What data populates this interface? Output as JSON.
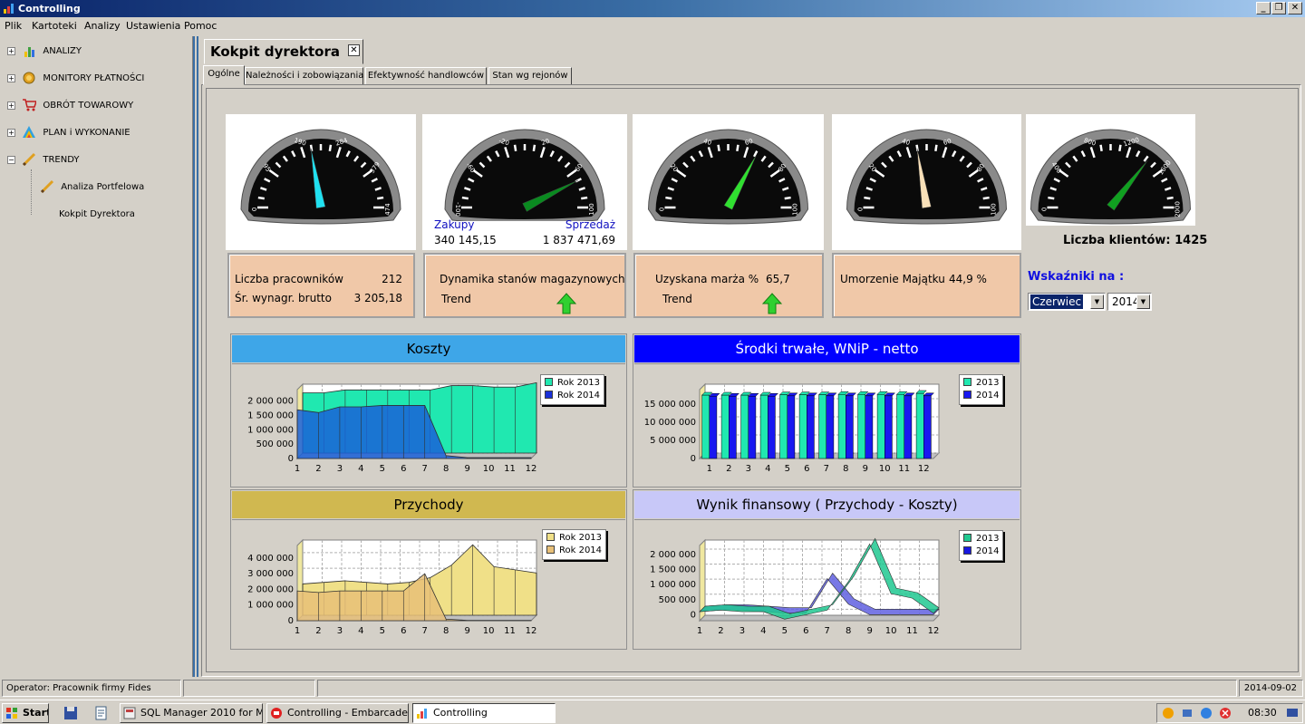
{
  "window": {
    "title": "Controlling",
    "minimize": "_",
    "restore": "❐",
    "close": "✕"
  },
  "menu": [
    "Plik",
    "Kartoteki",
    "Analizy",
    "Ustawienia",
    "Pomoc"
  ],
  "tree": [
    {
      "label": "ANALIZY",
      "expander": "+"
    },
    {
      "label": "MONITORY PŁATNOŚCI",
      "expander": "+"
    },
    {
      "label": "OBRÓT TOWAROWY",
      "expander": "+"
    },
    {
      "label": "PLAN i WYKONANIE",
      "expander": "+"
    },
    {
      "label": "TRENDY",
      "expander": "−"
    },
    {
      "label": "Analiza Portfelowa"
    },
    {
      "label": "Kokpit Dyrektora"
    }
  ],
  "document_tab": {
    "title": "Kokpit dyrektora",
    "close": "✕"
  },
  "tabs": [
    "Ogólne",
    "Należności i zobowiązania",
    "Efektywność handlowców",
    "Stan wg rejonów"
  ],
  "gauges": [
    {
      "ticks": [
        "0",
        "95",
        "190",
        "284",
        "379",
        "474"
      ],
      "max": 474,
      "value": 212,
      "needle_color": "#20e0f0"
    },
    {
      "ticks": [
        "-100",
        "-60",
        "-20",
        "20",
        "60",
        "100"
      ],
      "max": 100,
      "min": -100,
      "value": 70,
      "needle_color": "#0a8a20"
    },
    {
      "ticks": [
        "0",
        "20",
        "40",
        "60",
        "80",
        "100"
      ],
      "max": 100,
      "value": 65.7,
      "needle_color": "#30e030"
    },
    {
      "ticks": [
        "0",
        "20",
        "40",
        "60",
        "80",
        "100"
      ],
      "max": 100,
      "value": 44.9,
      "needle_color": "#f8e0b8"
    },
    {
      "ticks": [
        "0",
        "400",
        "800",
        "1200",
        "1600",
        "2000"
      ],
      "max": 2000,
      "value": 1425,
      "needle_color": "#10a020"
    }
  ],
  "gauge2": {
    "left_label": "Zakupy",
    "right_label": "Sprzedaż",
    "left_value": "340 145,15",
    "right_value": "1 837 471,69"
  },
  "info": {
    "employees_label": "Liczba pracowników",
    "employees_value": "212",
    "salary_label": "Śr. wynagr. brutto",
    "salary_value": "3 205,18",
    "stock_label": "Dynamika stanów magazynowych",
    "stock_trend_label": "Trend",
    "margin_label": "Uzyskana marża %",
    "margin_value": "65,7",
    "margin_trend_label": "Trend",
    "depr_label": "Umorzenie Majątku",
    "depr_value": "44,9 %"
  },
  "clients": "Liczba klientów: 1425",
  "indicators": {
    "label": "Wskaźniki na :",
    "month": "Czerwiec",
    "year": "2014",
    "arrow": "▼"
  },
  "colors": {
    "koszty_header": "#3ea6e8",
    "srodki_header": "#0000ff",
    "przychody_header": "#d0b850",
    "wynik_header": "#c8c8f8",
    "info_bg": "#f0c8a8",
    "trend_up": "#30d030"
  },
  "chart_data": [
    {
      "type": "area",
      "title": "Koszty",
      "categories": [
        "1",
        "2",
        "3",
        "4",
        "5",
        "6",
        "7",
        "8",
        "9",
        "10",
        "11",
        "12"
      ],
      "yticks": [
        "0",
        "500 000",
        "1 000 000",
        "1 500 000",
        "2 000 000"
      ],
      "ylim": [
        0,
        2400000
      ],
      "series": [
        {
          "name": "Rok 2013",
          "color": "#20e8b0",
          "values": [
            2100000,
            2100000,
            2200000,
            2200000,
            2200000,
            2200000,
            2200000,
            2350000,
            2350000,
            2300000,
            2300000,
            2450000
          ]
        },
        {
          "name": "Rok 2014",
          "color": "#1a60d8",
          "values": [
            1700000,
            1600000,
            1800000,
            1800000,
            1850000,
            1850000,
            1850000,
            100000,
            30000,
            30000,
            30000,
            30000
          ]
        }
      ]
    },
    {
      "type": "bar",
      "title": "Środki trwałe, WNiP - netto",
      "categories": [
        "1",
        "2",
        "3",
        "4",
        "5",
        "6",
        "7",
        "8",
        "9",
        "10",
        "11",
        "12"
      ],
      "yticks": [
        "0",
        "5 000 000",
        "10 000 000",
        "15 000 000"
      ],
      "ylim": [
        0,
        19000000
      ],
      "series": [
        {
          "name": "2013",
          "color": "#20e8b0",
          "values": [
            17500000,
            17500000,
            17500000,
            17500000,
            17600000,
            17600000,
            17600000,
            17700000,
            17700000,
            17700000,
            17700000,
            18000000
          ]
        },
        {
          "name": "2014",
          "color": "#1818f0",
          "values": [
            17200000,
            17200000,
            17200000,
            17200000,
            17300000,
            17300000,
            17300000,
            17300000,
            17300000,
            17300000,
            17300000,
            17300000
          ]
        }
      ]
    },
    {
      "type": "area",
      "title": "Przychody",
      "categories": [
        "1",
        "2",
        "3",
        "4",
        "5",
        "6",
        "7",
        "8",
        "9",
        "10",
        "11",
        "12"
      ],
      "yticks": [
        "0",
        "1 000 000",
        "2 000 000",
        "3 000 000",
        "4 000 000"
      ],
      "ylim": [
        0,
        4800000
      ],
      "series": [
        {
          "name": "Rok 2013",
          "color": "#f0e088",
          "values": [
            2000000,
            2100000,
            2200000,
            2100000,
            2000000,
            2100000,
            2400000,
            3200000,
            4500000,
            3100000,
            2900000,
            2700000
          ]
        },
        {
          "name": "Rok 2014",
          "color": "#e8c078",
          "values": [
            1900000,
            1800000,
            1900000,
            1900000,
            1900000,
            1900000,
            3000000,
            100000,
            20000,
            20000,
            20000,
            20000
          ]
        }
      ]
    },
    {
      "type": "line",
      "title": "Wynik finansowy  ( Przychody - Koszty)",
      "categories": [
        "1",
        "2",
        "3",
        "4",
        "5",
        "6",
        "7",
        "8",
        "9",
        "10",
        "11",
        "12"
      ],
      "yticks": [
        "0",
        "500 000",
        "1 000 000",
        "1 500 000",
        "2 000 000"
      ],
      "ylim": [
        -200000,
        2300000
      ],
      "series": [
        {
          "name": "2013",
          "color": "#20c890",
          "values": [
            100000,
            150000,
            100000,
            100000,
            -150000,
            0,
            150000,
            1100000,
            2350000,
            700000,
            550000,
            50000
          ]
        },
        {
          "name": "2014",
          "color": "#6060e0",
          "values": [
            100000,
            150000,
            150000,
            100000,
            50000,
            50000,
            1200000,
            350000,
            0,
            0,
            0,
            0
          ]
        }
      ]
    }
  ],
  "status": {
    "operator": "Operator: Pracownik firmy Fides",
    "date": "2014-09-02"
  },
  "taskbar": {
    "start": "Start",
    "items": [
      "SQL Manager 2010 for M...",
      "Controlling - Embarcader...",
      "Controlling"
    ],
    "clock": "08:30"
  }
}
